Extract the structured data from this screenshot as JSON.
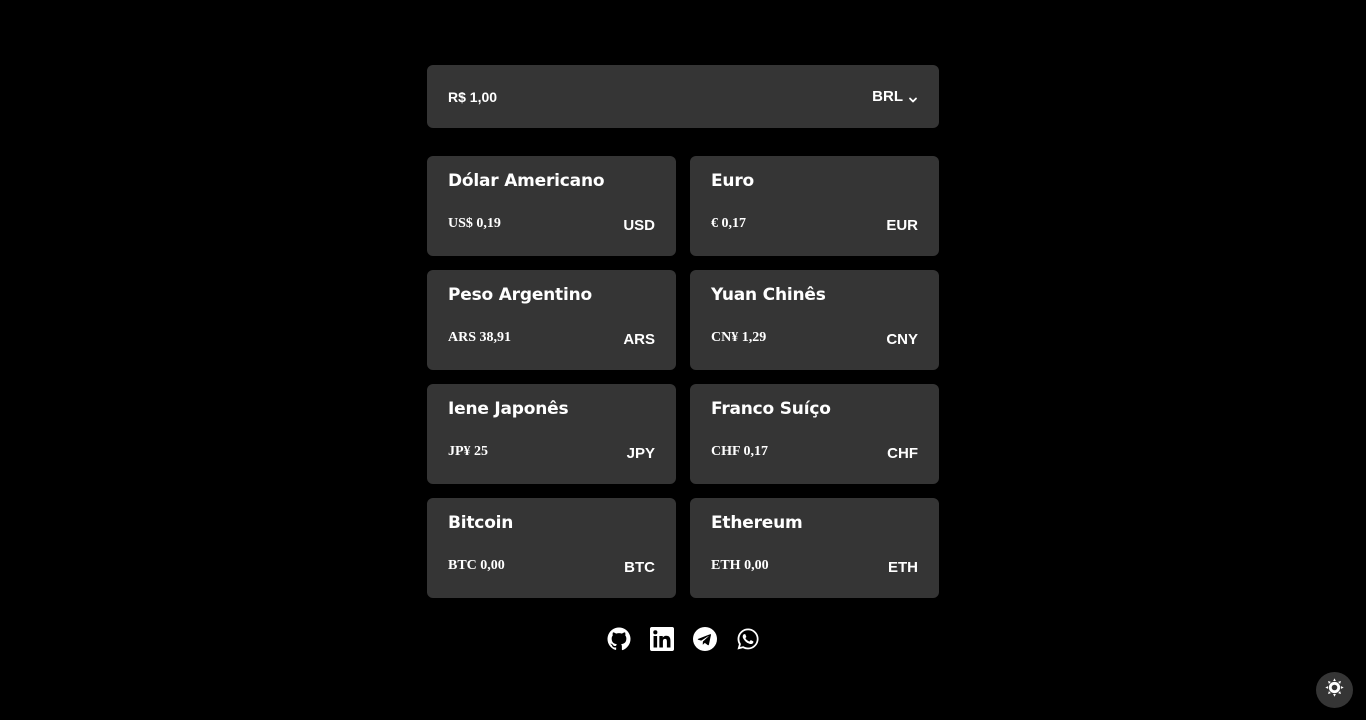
{
  "converter": {
    "amount_value": "R$ 1,00",
    "selected_currency": "BRL",
    "chevron_icon": "chevron-down-icon"
  },
  "currencies": [
    {
      "name": "Dólar Americano",
      "value": "US$ 0,19",
      "code": "USD"
    },
    {
      "name": "Euro",
      "value": "€ 0,17",
      "code": "EUR"
    },
    {
      "name": "Peso Argentino",
      "value": "ARS 38,91",
      "code": "ARS"
    },
    {
      "name": "Yuan Chinês",
      "value": "CN¥ 1,29",
      "code": "CNY"
    },
    {
      "name": "Iene Japonês",
      "value": "JP¥ 25",
      "code": "JPY"
    },
    {
      "name": "Franco Suíço",
      "value": "CHF 0,17",
      "code": "CHF"
    },
    {
      "name": "Bitcoin",
      "value": "BTC 0,00",
      "code": "BTC"
    },
    {
      "name": "Ethereum",
      "value": "ETH 0,00",
      "code": "ETH"
    }
  ],
  "social_links": [
    "github-icon",
    "linkedin-icon",
    "telegram-icon",
    "whatsapp-icon"
  ],
  "theme_toggle_icon": "sun-icon",
  "colors": {
    "background": "#000000",
    "card": "#353535",
    "text": "#ffffff"
  }
}
